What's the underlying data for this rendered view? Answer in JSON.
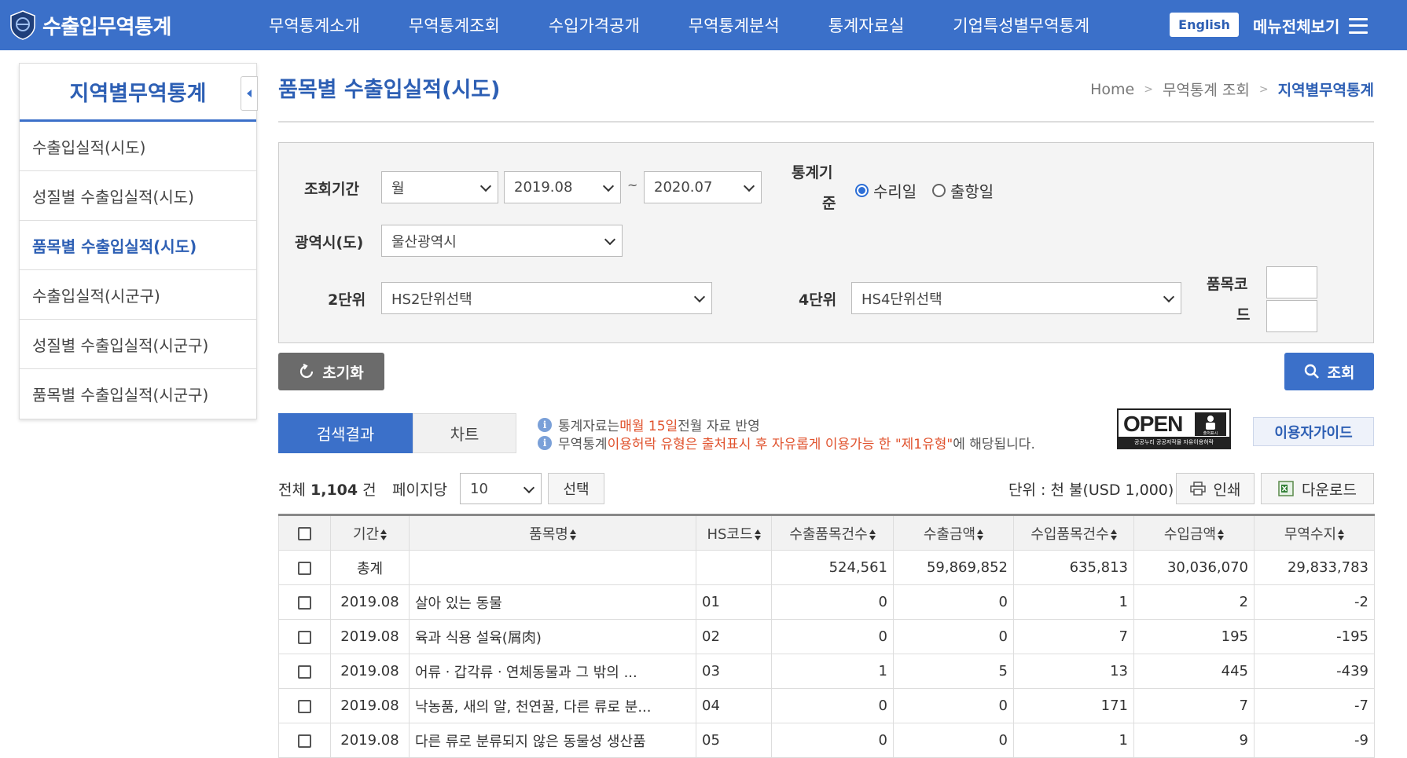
{
  "header": {
    "logo_text": "수출입무역통계",
    "nav": [
      "무역통계소개",
      "무역통계조회",
      "수입가격공개",
      "무역통계분석",
      "통계자료실",
      "기업특성별무역통계"
    ],
    "lang_label": "English",
    "menu_all_label": "메뉴전체보기",
    "accent": "#3b70c9"
  },
  "sidebar": {
    "title": "지역별무역통계",
    "items": [
      {
        "label": "수출입실적(시도)"
      },
      {
        "label": "성질별 수출입실적(시도)"
      },
      {
        "label": "품목별 수출입실적(시도)",
        "active": true
      },
      {
        "label": "수출입실적(시군구)"
      },
      {
        "label": "성질별 수출입실적(시군구)"
      },
      {
        "label": "품목별 수출입실적(시군구)"
      }
    ]
  },
  "page": {
    "title": "품목별 수출입실적(시도)",
    "breadcrumb": [
      "Home",
      "무역통계 조회",
      "지역별무역통계"
    ]
  },
  "search": {
    "period_label": "조회기간",
    "period_unit": "월",
    "period_from": "2019.08",
    "period_sep": "~",
    "period_to": "2020.07",
    "basis_label_1": "통계기",
    "basis_label_2": "준",
    "basis_options": [
      "수리일",
      "출항일"
    ],
    "basis_selected": "수리일",
    "region_label": "광역시(도)",
    "region_value": "울산광역시",
    "hs2_label": "2단위",
    "hs2_value": "HS2단위선택",
    "hs4_label": "4단위",
    "hs4_value": "HS4단위선택",
    "item_code_label_1": "품목코",
    "item_code_label_2": "드",
    "reset_label": "초기화",
    "search_label": "조회"
  },
  "tabs": {
    "result": "검색결과",
    "chart": "차트"
  },
  "notices": {
    "line1_a": "통계자료는 ",
    "line1_hl": "매월 15일",
    "line1_b": " 전월 자료 반영",
    "line2_a": "무역통계 ",
    "line2_hl": "이용허락 유형은 출처표시 후 자유롭게 이용가능 한 \"제1유형\"",
    "line2_b": "에 해당됩니다.",
    "open_text": "OPEN",
    "open_sub": "공공누리 공공저작물 자유이용허락",
    "open_tag": "출처표시",
    "guide_label": "이용자가이드"
  },
  "results": {
    "total_prefix": "전체 ",
    "total_count": "1,104",
    "total_suffix": " 건",
    "per_page_label": "페이지당",
    "per_page_value": "10",
    "select_label": "선택",
    "unit_label": "단위 : 천 불(USD 1,000)",
    "print_label": "인쇄",
    "download_label": "다운로드",
    "columns": [
      "기간",
      "품목명",
      "HS코드",
      "수출품목건수",
      "수출금액",
      "수입품목건수",
      "수입금액",
      "무역수지"
    ],
    "rows": [
      {
        "period": "총계",
        "name": "",
        "hs": "",
        "exp_cnt": "524,561",
        "exp_amt": "59,869,852",
        "imp_cnt": "635,813",
        "imp_amt": "30,036,070",
        "balance": "29,833,783"
      },
      {
        "period": "2019.08",
        "name": "살아 있는 동물",
        "hs": "01",
        "exp_cnt": "0",
        "exp_amt": "0",
        "imp_cnt": "1",
        "imp_amt": "2",
        "balance": "-2"
      },
      {
        "period": "2019.08",
        "name": "육과 식용 설육(屑肉)",
        "hs": "02",
        "exp_cnt": "0",
        "exp_amt": "0",
        "imp_cnt": "7",
        "imp_amt": "195",
        "balance": "-195"
      },
      {
        "period": "2019.08",
        "name": "어류ㆍ갑각류ㆍ연체동물과 그 밖의 ...",
        "hs": "03",
        "exp_cnt": "1",
        "exp_amt": "5",
        "imp_cnt": "13",
        "imp_amt": "445",
        "balance": "-439"
      },
      {
        "period": "2019.08",
        "name": "낙농품, 새의 알, 천연꿀, 다른 류로 분...",
        "hs": "04",
        "exp_cnt": "0",
        "exp_amt": "0",
        "imp_cnt": "171",
        "imp_amt": "7",
        "balance": "-7"
      },
      {
        "period": "2019.08",
        "name": "다른 류로 분류되지 않은 동물성 생산품",
        "hs": "05",
        "exp_cnt": "0",
        "exp_amt": "0",
        "imp_cnt": "1",
        "imp_amt": "9",
        "balance": "-9"
      }
    ]
  }
}
